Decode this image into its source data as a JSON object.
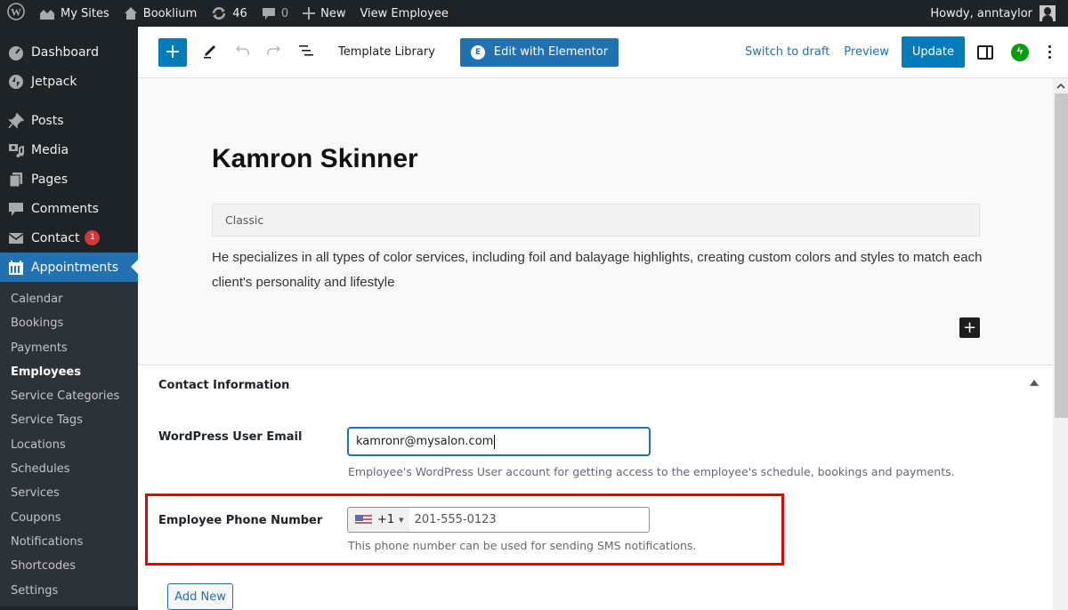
{
  "admin_bar": {
    "my_sites": "My Sites",
    "site_name": "Booklium",
    "updates_count": "46",
    "comments_count": "0",
    "new_label": "New",
    "view_label": "View Employee",
    "greeting": "Howdy, anntaylor"
  },
  "sidebar": {
    "items": [
      {
        "label": "Dashboard",
        "icon": "dashboard-icon"
      },
      {
        "label": "Jetpack",
        "icon": "jetpack-icon"
      },
      {
        "label": "Posts",
        "icon": "pin-icon"
      },
      {
        "label": "Media",
        "icon": "media-icon"
      },
      {
        "label": "Pages",
        "icon": "pages-icon"
      },
      {
        "label": "Comments",
        "icon": "comment-icon"
      },
      {
        "label": "Contact",
        "icon": "mail-icon",
        "badge": "1"
      },
      {
        "label": "Appointments",
        "icon": "calendar-icon",
        "active": true
      }
    ],
    "submenu": [
      {
        "label": "Calendar"
      },
      {
        "label": "Bookings"
      },
      {
        "label": "Payments"
      },
      {
        "label": "Employees",
        "current": true
      },
      {
        "label": "Service Categories"
      },
      {
        "label": "Service Tags"
      },
      {
        "label": "Locations"
      },
      {
        "label": "Schedules"
      },
      {
        "label": "Services"
      },
      {
        "label": "Coupons"
      },
      {
        "label": "Notifications"
      },
      {
        "label": "Shortcodes"
      },
      {
        "label": "Settings"
      }
    ]
  },
  "toolbar": {
    "template_library": "Template Library",
    "edit_elementor": "Edit with Elementor",
    "elementor_glyph": "E",
    "switch_to_draft": "Switch to draft",
    "preview": "Preview",
    "update": "Update"
  },
  "editor": {
    "title": "Kamron Skinner",
    "classic_block_label": "Classic",
    "body": "He specializes in all types of color services, including foil and balayage highlights, creating custom colors and styles to match each client's personality and lifestyle"
  },
  "contact_info": {
    "section_title": "Contact Information",
    "email_label": "WordPress User Email",
    "email_value": "kamronr@mysalon.com",
    "email_help": "Employee's WordPress User account for getting access to the employee's schedule, bookings and payments.",
    "phone_label": "Employee Phone Number",
    "phone_country": "US",
    "phone_dial_code": "+1",
    "phone_value": "201-555-0123",
    "phone_help": "This phone number can be used for sending SMS notifications.",
    "add_new": "Add New"
  },
  "colors": {
    "accent": "#2271b1",
    "admin_bar_bg": "#1d2327",
    "highlight_border": "#e60000",
    "badge": "#d63638",
    "jetpack_green": "#069e08"
  }
}
